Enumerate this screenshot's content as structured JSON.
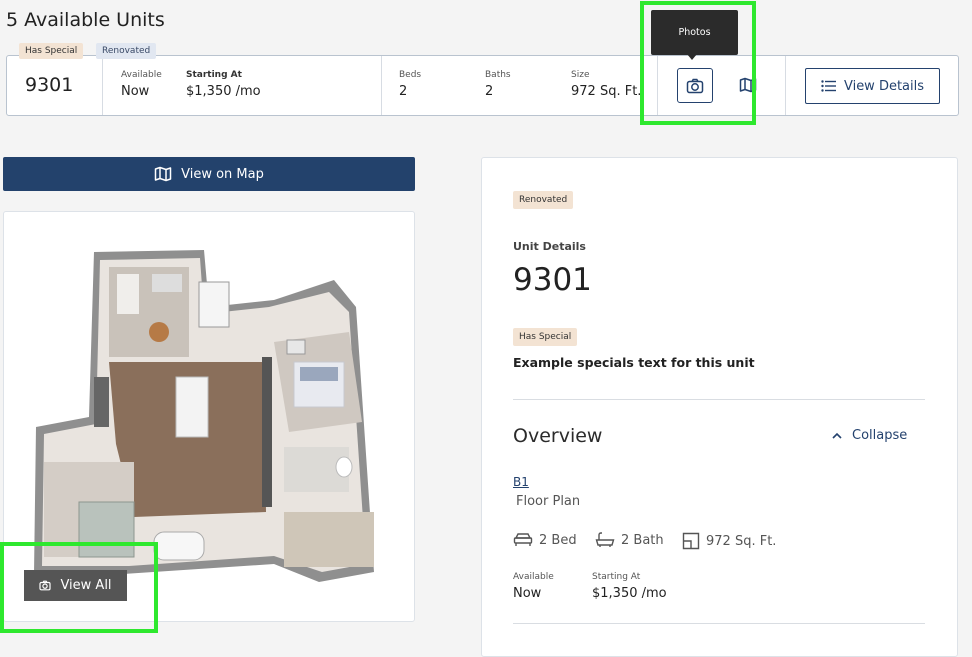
{
  "page": {
    "title": "5 Available Units"
  },
  "unit_row": {
    "special_tag": "Has Special",
    "renovated_tag": "Renovated",
    "unit_number": "9301",
    "available_label": "Available",
    "available_value": "Now",
    "starting_label": "Starting At",
    "starting_value": "$1,350 /mo",
    "beds_label": "Beds",
    "beds_value": "2",
    "baths_label": "Baths",
    "baths_value": "2",
    "size_label": "Size",
    "size_value": "972 Sq. Ft.",
    "view_details_label": "View Details"
  },
  "tooltip": {
    "text": "Photos"
  },
  "map_button": {
    "label": "View on Map"
  },
  "floorplan": {
    "view_all_label": "View All"
  },
  "details": {
    "renovated_tag": "Renovated",
    "unit_details_label": "Unit Details",
    "unit_number": "9301",
    "special_tag": "Has Special",
    "special_text": "Example specials text for this unit",
    "overview_title": "Overview",
    "collapse_label": "Collapse",
    "floor_plan_code": "B1",
    "floor_plan_label": "Floor Plan",
    "beds": "2 Bed",
    "baths": "2 Bath",
    "size": "972 Sq. Ft.",
    "available_label": "Available",
    "available_value": "Now",
    "starting_label": "Starting At",
    "starting_value": "$1,350 /mo"
  },
  "colors": {
    "primary": "#23426c",
    "highlight": "#2ee82e",
    "special_tag_bg": "#f3e3d3",
    "renovated_tag_bg": "#e1e7f1"
  },
  "icons": [
    "camera-icon",
    "map-icon",
    "list-icon",
    "chevron-up-icon",
    "car-icon",
    "bath-icon",
    "size-icon"
  ]
}
